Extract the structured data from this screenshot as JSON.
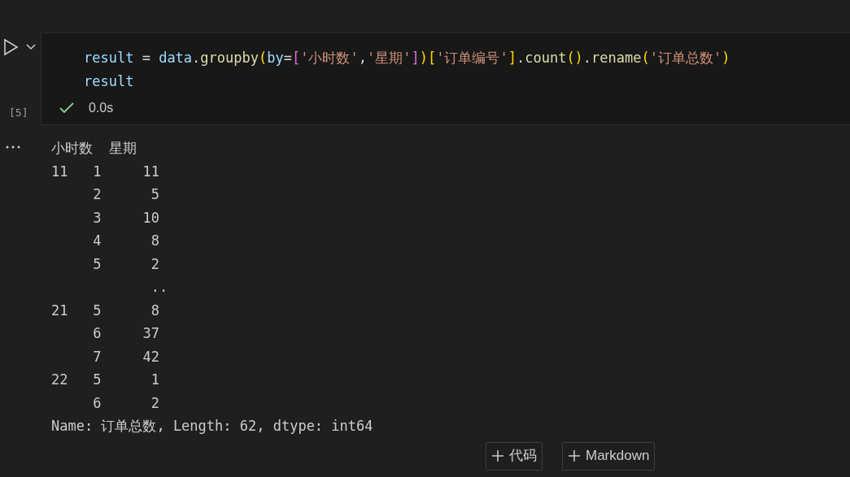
{
  "cell": {
    "execution_count": "[5]",
    "code_lines": [
      [
        {
          "kind": "var",
          "text": "result"
        },
        {
          "kind": "plain",
          "text": " = "
        },
        {
          "kind": "var",
          "text": "data"
        },
        {
          "kind": "plain",
          "text": "."
        },
        {
          "kind": "fn",
          "text": "groupby"
        },
        {
          "kind": "b1",
          "text": "("
        },
        {
          "kind": "var",
          "text": "by"
        },
        {
          "kind": "plain",
          "text": "="
        },
        {
          "kind": "b2",
          "text": "["
        },
        {
          "kind": "str",
          "text": "'小时数'"
        },
        {
          "kind": "plain",
          "text": ","
        },
        {
          "kind": "str",
          "text": "'星期'"
        },
        {
          "kind": "b2",
          "text": "]"
        },
        {
          "kind": "b1",
          "text": ")"
        },
        {
          "kind": "b1",
          "text": "["
        },
        {
          "kind": "str",
          "text": "'订单编号'"
        },
        {
          "kind": "b1",
          "text": "]"
        },
        {
          "kind": "plain",
          "text": "."
        },
        {
          "kind": "fn",
          "text": "count"
        },
        {
          "kind": "b1",
          "text": "()"
        },
        {
          "kind": "plain",
          "text": "."
        },
        {
          "kind": "fn",
          "text": "rename"
        },
        {
          "kind": "b1",
          "text": "("
        },
        {
          "kind": "str",
          "text": "'订单总数'"
        },
        {
          "kind": "b1",
          "text": ")"
        }
      ],
      [
        {
          "kind": "var",
          "text": "result"
        }
      ]
    ],
    "succeeded": true,
    "duration": "0.0s"
  },
  "output": {
    "lines": [
      "小时数  星期",
      "11   1     11",
      "     2      5",
      "     3     10",
      "     4      8",
      "     5      2",
      "            ..",
      "21   5      8",
      "     6     37",
      "     7     42",
      "22   5      1",
      "     6      2",
      "Name: 订单总数, Length: 62, dtype: int64"
    ]
  },
  "add_buttons": [
    "代码",
    "Markdown"
  ]
}
